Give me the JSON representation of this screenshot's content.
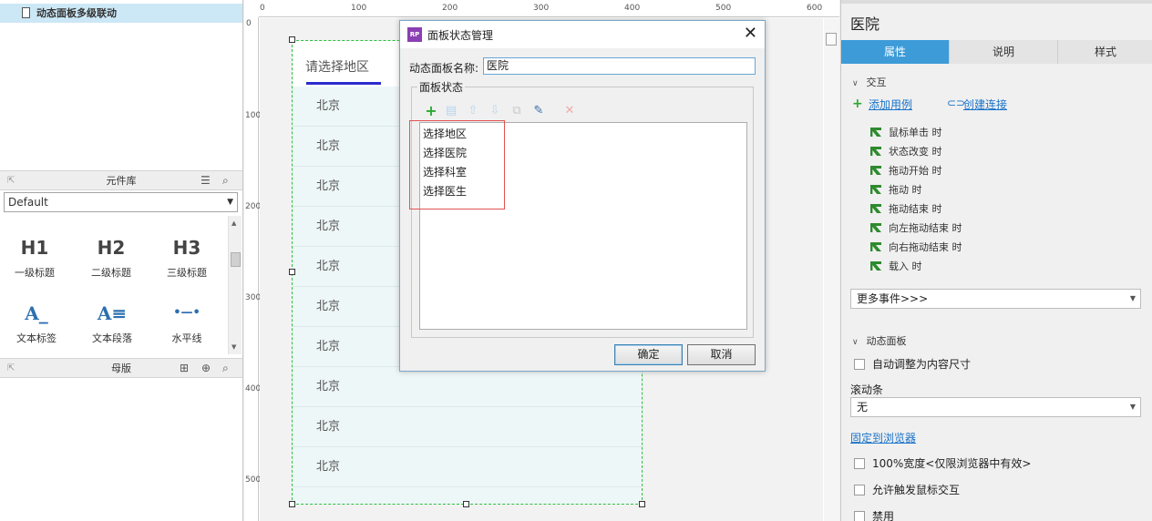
{
  "left": {
    "page_name": "动态面板多级联动",
    "library_panel": {
      "title": "元件库",
      "selected_library": "Default",
      "widgets": [
        {
          "glyph": "H1",
          "label": "一级标题",
          "icon": "h1-icon"
        },
        {
          "glyph": "H2",
          "label": "二级标题",
          "icon": "h2-icon"
        },
        {
          "glyph": "H3",
          "label": "三级标题",
          "icon": "h3-icon"
        },
        {
          "glyph": "A_",
          "label": "文本标签",
          "icon": "text-label-icon"
        },
        {
          "glyph": "A≡",
          "label": "文本段落",
          "icon": "text-paragraph-icon"
        },
        {
          "glyph": "•—•",
          "label": "水平线",
          "icon": "horizontal-line-icon"
        }
      ]
    },
    "masters_panel": {
      "title": "母版"
    }
  },
  "canvas": {
    "ruler_top": [
      "0",
      "100",
      "200",
      "300",
      "400",
      "500",
      "600"
    ],
    "ruler_left": [
      "0",
      "100",
      "200",
      "300",
      "400",
      "500"
    ],
    "panel_tab": "请选择地区",
    "rows": [
      "北京",
      "北京",
      "北京",
      "北京",
      "北京",
      "北京",
      "北京",
      "北京",
      "北京",
      "北京"
    ]
  },
  "dialog": {
    "title": "面板状态管理",
    "name_label": "动态面板名称:",
    "name_value": "医院",
    "states_legend": "面板状态",
    "states": [
      "选择地区",
      "选择医院",
      "选择科室",
      "选择医生"
    ],
    "ok_label": "确定",
    "cancel_label": "取消"
  },
  "right": {
    "title": "医院",
    "tabs": [
      "属性",
      "说明",
      "样式"
    ],
    "interaction_section": "交互",
    "add_case": "添加用例",
    "create_link": "创建连接",
    "events": [
      "鼠标单击 时",
      "状态改变 时",
      "拖动开始 时",
      "拖动 时",
      "拖动结束 时",
      "向左拖动结束 时",
      "向右拖动结束 时",
      "载入 时"
    ],
    "more_events": "更多事件>>>",
    "dynamic_panel_section": "动态面板",
    "auto_fit": "自动调整为内容尺寸",
    "scrollbar_label": "滚动条",
    "scrollbar_value": "无",
    "pin_to_browser": "固定到浏览器",
    "full_width": "100%宽度<仅限浏览器中有效>",
    "allow_mouse": "允许触发鼠标交互",
    "disabled": "禁用"
  },
  "colors": {
    "accent": "#3d9bd8",
    "selection": "#2fbf3f",
    "highlight_box": "#e05252",
    "tab_underline": "#2b2bcc"
  }
}
